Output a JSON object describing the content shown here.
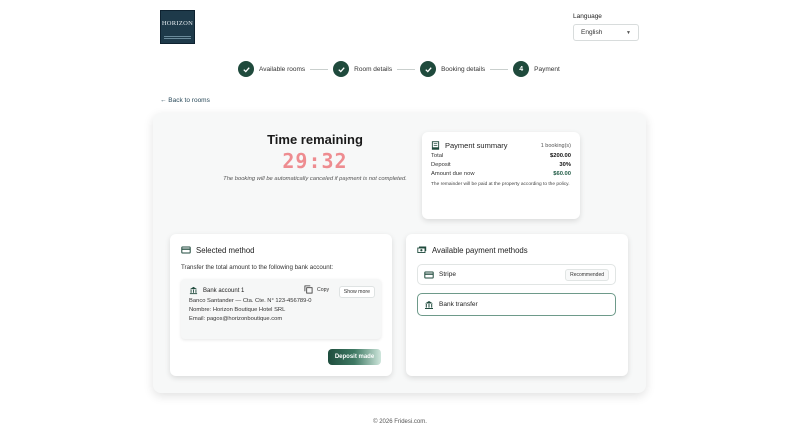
{
  "logo": {
    "name": "HORIZON"
  },
  "language": {
    "label": "Language",
    "selected": "English"
  },
  "steps": [
    {
      "label": "Available rooms",
      "status": "done"
    },
    {
      "label": "Room details",
      "status": "done"
    },
    {
      "label": "Booking details",
      "status": "done"
    },
    {
      "number": "4",
      "label": "Payment",
      "status": "current"
    }
  ],
  "back_link": "← Back to rooms",
  "timer": {
    "title": "Time remaining",
    "value": "29:32",
    "note": "The booking will be automatically canceled if payment is not completed."
  },
  "summary": {
    "title": "Payment summary",
    "count": "1 booking(s)",
    "rows": [
      {
        "label": "Total",
        "value": "$200.00"
      },
      {
        "label": "Deposit",
        "value": "30%"
      },
      {
        "label": "Amount due now",
        "value": "$60.00"
      }
    ],
    "note": "The remainder will be paid at the property according to the policy."
  },
  "selected_method": {
    "title": "Selected method",
    "instruction": "Transfer the total amount to the following bank account:",
    "bank": {
      "name": "Bank account 1",
      "copy_label": "Copy",
      "more_label": "Show more",
      "lines": [
        "Banco Santander — Cta. Cte. N° 123-456789-0",
        "Nombre: Horizon Boutique Hotel SRL",
        "Email: pagos@horizonboutique.com"
      ]
    },
    "deposit_button": "Deposit made"
  },
  "available_methods": {
    "title": "Available payment methods",
    "methods": [
      {
        "name": "Stripe",
        "badge": "Recommended"
      },
      {
        "name": "Bank transfer"
      }
    ]
  },
  "footer": "© 2026 Fridesi.com.",
  "colors": {
    "primary": "#1f4a3c",
    "timer": "#ee8c90"
  }
}
